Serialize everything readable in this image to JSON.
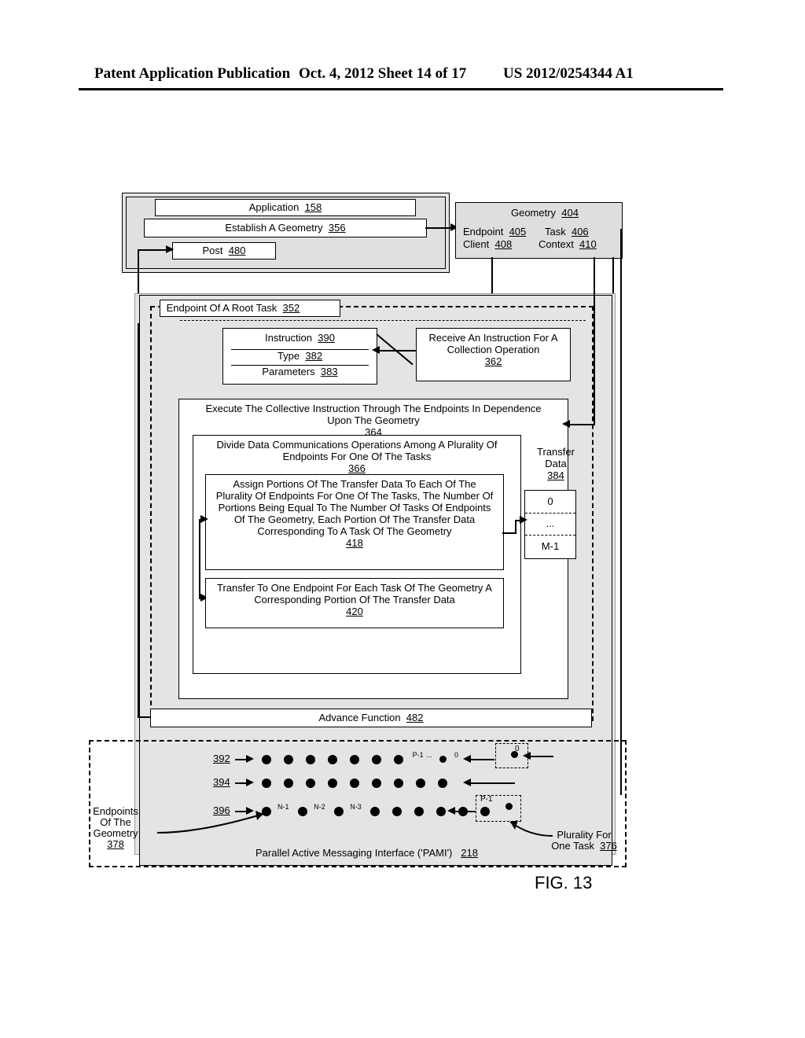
{
  "header": {
    "left": "Patent Application Publication",
    "mid": "Oct. 4, 2012  Sheet 14 of 17",
    "right": "US 2012/0254344 A1"
  },
  "top": {
    "application": "Application",
    "application_ref": "158",
    "establish": "Establish A Geometry",
    "establish_ref": "356",
    "post": "Post",
    "post_ref": "480"
  },
  "geometry": {
    "title": "Geometry",
    "title_ref": "404",
    "endpoint": "Endpoint",
    "endpoint_ref": "405",
    "task": "Task",
    "task_ref": "406",
    "client": "Client",
    "client_ref": "408",
    "context": "Context",
    "context_ref": "410"
  },
  "root": {
    "label": "Endpoint Of A Root Task",
    "ref": "352"
  },
  "instruction": {
    "title": "Instruction",
    "title_ref": "390",
    "type": "Type",
    "type_ref": "382",
    "params": "Parameters",
    "params_ref": "383"
  },
  "receive": {
    "text": "Receive An Instruction For A Collection Operation",
    "ref": "362"
  },
  "execute": {
    "text": "Execute The Collective Instruction Through The Endpoints In Dependence Upon The Geometry",
    "ref": "364"
  },
  "divide": {
    "text": "Divide Data Communications Operations Among A Plurality Of Endpoints For One Of The Tasks",
    "ref": "366"
  },
  "assign": {
    "text": "Assign Portions Of The Transfer Data To Each Of The Plurality Of Endpoints For One Of The Tasks, The Number Of Portions Being Equal To The Number Of Tasks Of Endpoints Of The Geometry, Each Portion Of The Transfer Data Corresponding To A Task Of The Geometry",
    "ref": "418"
  },
  "transfer": {
    "text": "Transfer To One Endpoint For Each Task Of The Geometry A Corresponding Portion Of The Transfer Data",
    "ref": "420"
  },
  "tdata": {
    "label_top": "Transfer",
    "label_bot": "Data",
    "ref": "384",
    "row0": "0",
    "row1": "...",
    "row2": "M-1"
  },
  "advance": {
    "text": "Advance Function",
    "ref": "482"
  },
  "rows": {
    "r1": "392",
    "r2": "394",
    "r3": "396"
  },
  "sup": {
    "p1": "P-1",
    "zero": "0",
    "n1": "N-1",
    "n2": "N-2",
    "n3": "N-3",
    "ell": "...",
    "pm1": "P-1"
  },
  "endpoints_label": {
    "l1": "Endpoints",
    "l2": "Of The",
    "l3": "Geometry",
    "ref": "378"
  },
  "plurality_label": {
    "l1": "Plurality For",
    "l2": "One Task",
    "ref": "376"
  },
  "pami": {
    "text": "Parallel Active Messaging Interface ('PAMI')",
    "ref": "218"
  },
  "caption": "FIG. 13"
}
